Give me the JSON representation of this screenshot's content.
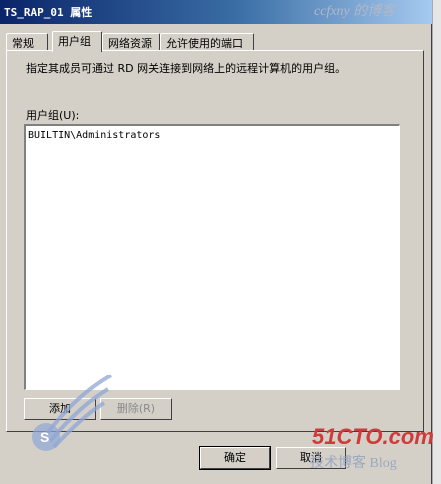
{
  "window": {
    "title": "TS_RAP_01 属性"
  },
  "tabs": [
    {
      "label": "常规",
      "active": false
    },
    {
      "label": "用户组",
      "active": true
    },
    {
      "label": "网络资源",
      "active": false
    },
    {
      "label": "允许使用的端口",
      "active": false
    }
  ],
  "content": {
    "description": "指定其成员可通过 RD 网关连接到网络上的远程计算机的用户组。",
    "list_label": "用户组(U):",
    "user_groups": [
      "BUILTIN\\Administrators"
    ]
  },
  "buttons": {
    "add": "添加",
    "delete": "删除(R)",
    "ok": "确定",
    "cancel": "取消"
  },
  "watermarks": {
    "top_right": "ccfxny 的博客",
    "logo_site": "51CTO.com",
    "logo_sub": "技术博客 Blog",
    "left_logo": "岁月联盟"
  },
  "colors": {
    "dialog_bg": "#d4d0c8",
    "title_gradient_start": "#0a246a",
    "title_gradient_end": "#a6caf0"
  }
}
